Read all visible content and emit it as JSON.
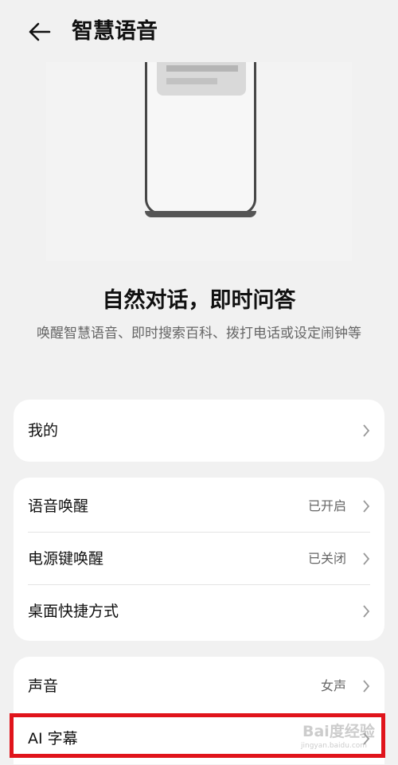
{
  "header": {
    "title": "智慧语音",
    "back_icon": "arrow-left-icon"
  },
  "intro": {
    "headline": "自然对话，即时问答",
    "description": "唤醒智慧语音、即时搜索百科、拨打电话或设定闹钟等"
  },
  "groups": [
    {
      "rows": [
        {
          "label": "我的",
          "value": ""
        }
      ]
    },
    {
      "rows": [
        {
          "label": "语音唤醒",
          "value": "已开启"
        },
        {
          "label": "电源键唤醒",
          "value": "已关闭"
        },
        {
          "label": "桌面快捷方式",
          "value": ""
        }
      ]
    },
    {
      "rows": [
        {
          "label": "声音",
          "value": "女声"
        },
        {
          "label": "AI 字幕",
          "value": ""
        }
      ]
    }
  ],
  "watermark": {
    "brand": "Bai度经验",
    "url": "jingyan.baidu.com"
  },
  "colors": {
    "highlight": "#e0141b",
    "card": "#ffffff",
    "background": "#f1f1f1"
  }
}
